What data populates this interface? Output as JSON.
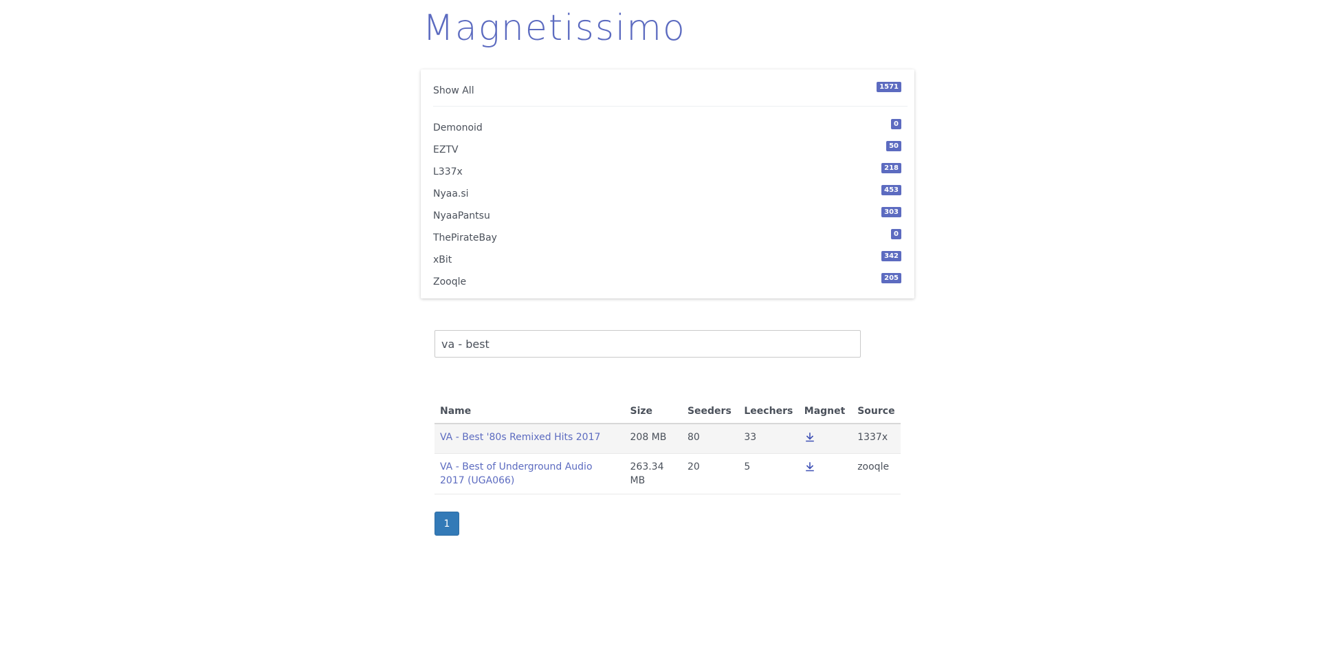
{
  "app": {
    "title": "Magnetissimo"
  },
  "sources": {
    "show_all": {
      "label": "Show All",
      "count": "1571"
    },
    "items": [
      {
        "label": "Demonoid",
        "count": "0"
      },
      {
        "label": "EZTV",
        "count": "50"
      },
      {
        "label": "L337x",
        "count": "218"
      },
      {
        "label": "Nyaa.si",
        "count": "453"
      },
      {
        "label": "NyaaPantsu",
        "count": "303"
      },
      {
        "label": "ThePirateBay",
        "count": "0"
      },
      {
        "label": "xBit",
        "count": "342"
      },
      {
        "label": "Zooqle",
        "count": "205"
      }
    ]
  },
  "search": {
    "value": "va - best"
  },
  "table": {
    "headers": [
      "Name",
      "Size",
      "Seeders",
      "Leechers",
      "Magnet",
      "Source"
    ],
    "rows": [
      {
        "name": "VA - Best '80s Remixed Hits 2017",
        "size": "208 MB",
        "seeders": "80",
        "leechers": "33",
        "magnet_icon": "download-icon",
        "source": "1337x"
      },
      {
        "name": "VA - Best of Underground Audio 2017 (UGA066)",
        "size": "263.34 MB",
        "seeders": "20",
        "leechers": "5",
        "magnet_icon": "download-icon",
        "source": "zooqle"
      }
    ]
  },
  "pagination": {
    "current_page": "1"
  },
  "colors": {
    "accent": "#5c6bc0",
    "page_button": "#337ab7"
  }
}
